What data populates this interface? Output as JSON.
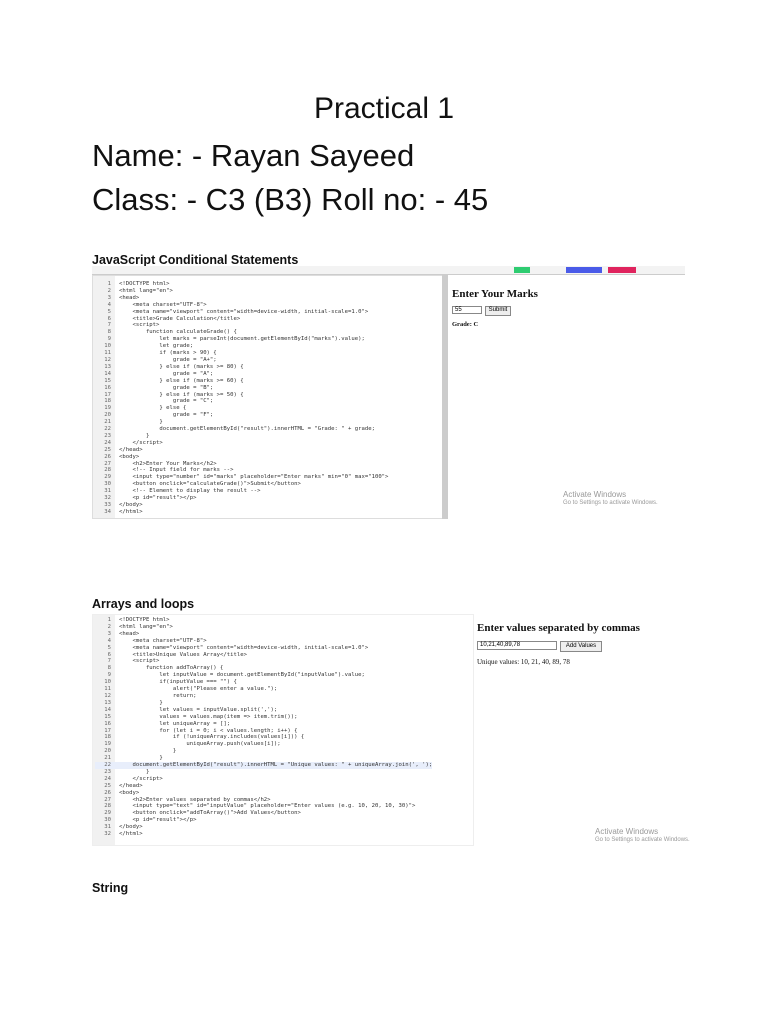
{
  "title": "Practical 1",
  "name_line": "Name: - Rayan Sayeed",
  "class_line": "Class: - C3 (B3) Roll no: - 45",
  "sections": [
    {
      "heading": "JavaScript Conditional Statements",
      "code": [
        "<!DOCTYPE html>",
        "<html lang=\"en\">",
        "<head>",
        "    <meta charset=\"UTF-8\">",
        "    <meta name=\"viewport\" content=\"width=device-width, initial-scale=1.0\">",
        "    <title>Grade Calculation</title>",
        "    <script>",
        "        function calculateGrade() {",
        "            let marks = parseInt(document.getElementById(\"marks\").value);",
        "            let grade;",
        "            if (marks > 90) {",
        "                grade = \"A+\";",
        "            } else if (marks >= 80) {",
        "                grade = \"A\";",
        "            } else if (marks >= 60) {",
        "                grade = \"B\";",
        "            } else if (marks >= 50) {",
        "                grade = \"C\";",
        "            } else {",
        "                grade = \"F\";",
        "            }",
        "            document.getElementById(\"result\").innerHTML = \"Grade: \" + grade;",
        "        }",
        "    </script>",
        "</head>",
        "<body>",
        "    <h2>Enter Your Marks</h2>",
        "    <!-- Input field for marks -->",
        "    <input type=\"number\" id=\"marks\" placeholder=\"Enter marks\" min=\"0\" max=\"100\">",
        "    <button onclick=\"calculateGrade()\">Submit</button>",
        "    <!-- Element to display the result -->",
        "    <p id=\"result\"></p>",
        "</body>",
        "</html>"
      ],
      "output": {
        "heading": "Enter Your Marks",
        "input_value": "55",
        "button": "Submit",
        "result": "Grade: C"
      },
      "watermark": [
        "Activate Windows",
        "Go to Settings to activate Windows."
      ]
    },
    {
      "heading": "Arrays and loops",
      "code": [
        "<!DOCTYPE html>",
        "<html lang=\"en\">",
        "<head>",
        "    <meta charset=\"UTF-8\">",
        "    <meta name=\"viewport\" content=\"width=device-width, initial-scale=1.0\">",
        "    <title>Unique Values Array</title>",
        "    <script>",
        "        function addToArray() {",
        "            let inputValue = document.getElementById(\"inputValue\").value;",
        "            if(inputValue === \"\") {",
        "                alert(\"Please enter a value.\");",
        "                return;",
        "            }",
        "            let values = inputValue.split(',');",
        "            values = values.map(item => item.trim());",
        "            let uniqueArray = [];",
        "            for (let i = 0; i < values.length; i++) {",
        "                if (!uniqueArray.includes(values[i])) {",
        "                    uniqueArray.push(values[i]);",
        "                }",
        "            }",
        "    document.getElementById(\"result\").innerHTML = \"Unique values: \" + uniqueArray.join(', ');",
        "        }",
        "    </script>",
        "</head>",
        "<body>",
        "    <h2>Enter values separated by commas</h2>",
        "    <input type=\"text\" id=\"inputValue\" placeholder=\"Enter values (e.g. 10, 20, 10, 30)\">",
        "    <button onclick=\"addToArray()\">Add Values</button>",
        "    <p id=\"result\"></p>",
        "</body>",
        "</html>"
      ],
      "output": {
        "heading": "Enter values separated by commas",
        "input_value": "10,21,40,89,78",
        "button": "Add Values",
        "result": "Unique values: 10, 21, 40, 89, 78"
      },
      "watermark": [
        "Activate Windows",
        "Go to Settings to activate Windows."
      ]
    },
    {
      "heading": "String"
    }
  ]
}
